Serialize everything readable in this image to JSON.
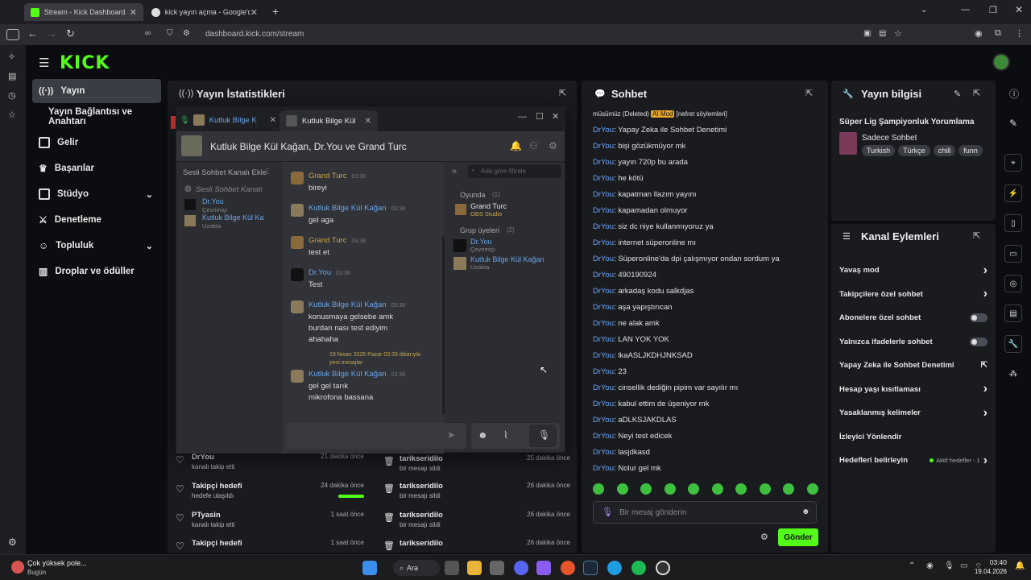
{
  "browser": {
    "tabs": [
      {
        "title": "Stream - Kick Dashboard",
        "close": "✕"
      },
      {
        "title": "kick yayın açma - Google'da Ara",
        "close": "✕"
      }
    ],
    "new_tab": "+",
    "url": "dashboard.kick.com/stream"
  },
  "nav": {
    "items": [
      {
        "label": "Yayın"
      },
      {
        "label": "Yayın Bağlantısı ve Anahtarı"
      },
      {
        "label": "Gelir"
      },
      {
        "label": "Başarılar"
      },
      {
        "label": "Stüdyo"
      },
      {
        "label": "Denetleme"
      },
      {
        "label": "Topluluk"
      },
      {
        "label": "Droplar ve ödüller"
      }
    ]
  },
  "stats": {
    "title": "Yayın İstatistikleri"
  },
  "chat": {
    "title": "Sohbet",
    "top_line": {
      "pre": "müsümüz (Deleted)",
      "badge": "AI Mod",
      "post": "[nefret söylemleri]"
    },
    "messages": [
      {
        "user": "DrYou",
        "text": "Yapay Zeka ile Sohbet Denetimi"
      },
      {
        "user": "DrYou",
        "text": "bişi gözükmüyor mk"
      },
      {
        "user": "DrYou",
        "text": "yayın 720p bu arada"
      },
      {
        "user": "DrYou",
        "text": "he kötü"
      },
      {
        "user": "DrYou",
        "text": "kapatman llazım yayını"
      },
      {
        "user": "DrYou",
        "text": "kapamadan olmuyor"
      },
      {
        "user": "DrYou",
        "text": "siz dc niye kullanmıyoruz ya"
      },
      {
        "user": "DrYou",
        "text": "internet süperonline mı"
      },
      {
        "user": "DrYou",
        "text": "Süperonline'da dpi çalışmıyor ondan sordum ya"
      },
      {
        "user": "DrYou",
        "text": "490190924"
      },
      {
        "user": "DrYou",
        "text": "arkadaş kodu salkdjas"
      },
      {
        "user": "DrYou",
        "text": "aşa yapıştırıcan"
      },
      {
        "user": "DrYou",
        "text": "ne alak amk"
      },
      {
        "user": "DrYou",
        "text": "LAN YOK YOK"
      },
      {
        "user": "DrYou",
        "text": "lkaASLJKDHJNKSAD"
      },
      {
        "user": "DrYou",
        "text": "23"
      },
      {
        "user": "DrYou",
        "text": "cinsellik dediğin pipim var sayılır mı"
      },
      {
        "user": "DrYou",
        "text": "kabul ettim de üşeniyor mk"
      },
      {
        "user": "DrYou",
        "text": "aDLKSJAKDLAS"
      },
      {
        "user": "DrYou",
        "text": "Neyi test edicek"
      },
      {
        "user": "DrYou",
        "text": "lasjdkasd"
      },
      {
        "user": "DrYou",
        "text": "Nolur gel mk"
      }
    ],
    "input_placeholder": "Bir mesaj gönderin",
    "send": "Gönder"
  },
  "stream_info": {
    "title": "Yayın bilgisi",
    "stream_title": "Süper Lig Şampiyonluk Yorumlama",
    "category": "Sadece Sohbet",
    "tags": [
      "Turkish",
      "Türkçe",
      "chill",
      "funn"
    ]
  },
  "channel_actions": {
    "title": "Kanal Eylemleri",
    "items": [
      {
        "label": "Yavaş mod",
        "control": "chevron"
      },
      {
        "label": "Takipçilere özel sohbet",
        "control": "chevron"
      },
      {
        "label": "Abonelere özel sohbet",
        "control": "toggle"
      },
      {
        "label": "Yalnızca ifadelerle sohbet",
        "control": "toggle"
      },
      {
        "label": "Yapay Zeka ile Sohbet Denetimi",
        "control": "external"
      },
      {
        "label": "Hesap yaşı kısıtlaması",
        "control": "chevron"
      },
      {
        "label": "Yasaklanmış kelimeler",
        "control": "chevron"
      },
      {
        "label": "İzleyici Yönlendir",
        "control": "none"
      },
      {
        "label": "Hedefleri belirleyin",
        "control": "chevron",
        "extra": "Aktif hedefler - 1"
      }
    ]
  },
  "activity_left": [
    {
      "title": "DrYou",
      "sub": "kanalı takip etti",
      "time": "21 dakika önce"
    },
    {
      "title": "Takipçi hedefi",
      "sub": "hedefe ulaşıldı",
      "time": "24 dakika önce"
    },
    {
      "title": "PTyasin",
      "sub": "kanalı takip etti",
      "time": "1 saat önce"
    },
    {
      "title": "Takipçi hedefi",
      "sub": "",
      "time": "1 saat önce"
    }
  ],
  "activity_right": [
    {
      "title": "tarikseridilo",
      "sub": "bir mesajı sildi",
      "time": "25 dakika önce"
    },
    {
      "title": "tarikseridilo",
      "sub": "bir mesajı sildi",
      "time": "26 dakika önce"
    },
    {
      "title": "tarikseridilo",
      "sub": "bir mesajı sildi",
      "time": "26 dakika önce"
    },
    {
      "title": "tarikseridilo",
      "sub": "",
      "time": "26 dakika önce"
    }
  ],
  "discord": {
    "tabs": [
      {
        "label": "Kutluk Bilge K"
      },
      {
        "label": "Kutluk Bilge Kül"
      }
    ],
    "group_title": "Kutluk Bilge Kül Kağan, Dr.You ve Grand Turc",
    "voice_header": "Sesli Sohbet Kanalı Ekle",
    "voice_channel": "Sesli Sohbet Kanalı",
    "voice_users": [
      {
        "name": "Dr.You",
        "status": "Çevrimiçi"
      },
      {
        "name": "Kutluk Bilge Kül Ka",
        "status": "Uzakta"
      }
    ],
    "search_placeholder": "Ada göre filtrele",
    "messages": [
      {
        "name": "Grand Turc",
        "time": "03:38",
        "text": [
          "bireyi"
        ],
        "color": "#c9a54d"
      },
      {
        "name": "Kutluk Bilge Kül Kağan",
        "time": "03:38",
        "text": [
          "gel aga"
        ],
        "color": "#6aa4e8"
      },
      {
        "name": "Grand Turc",
        "time": "03:38",
        "text": [
          "test et"
        ],
        "color": "#c9a54d"
      },
      {
        "name": "Dr.You",
        "time": "03:38",
        "text": [
          "Test"
        ],
        "color": "#6aa4e8"
      },
      {
        "name": "Kutluk Bilge Kül Kağan",
        "time": "03:39",
        "text": [
          "konusmaya gelsebe amk",
          "burdan nası test ediyim",
          "ahahaha"
        ],
        "color": "#6aa4e8"
      },
      {
        "name": "Kutluk Bilge Kül Kağan",
        "time": "03:39",
        "text": [
          "gel gel tarık",
          "mikrofona bassana"
        ],
        "color": "#6aa4e8"
      }
    ],
    "new_divider": "19 Nisan 2026 Pazar 03:39 itibarıyla",
    "new_label": "yeni mesajlar",
    "members_in_game": {
      "label": "Oyunda",
      "count": "(1)",
      "members": [
        {
          "name": "Grand Turc",
          "status": "OBS Studio"
        }
      ]
    },
    "members_group": {
      "label": "Grup üyeleri",
      "count": "(2)",
      "members": [
        {
          "name": "Dr.You",
          "status": "Çevrimiçi"
        },
        {
          "name": "Kutluk Bilge Kül Kağan",
          "status": "Uzakta"
        }
      ]
    }
  },
  "taskbar": {
    "weather_title": "Çok yüksek pole...",
    "weather_sub": "Bugün",
    "search": "Ara",
    "time": "03:40",
    "date": "19.04.2026"
  }
}
